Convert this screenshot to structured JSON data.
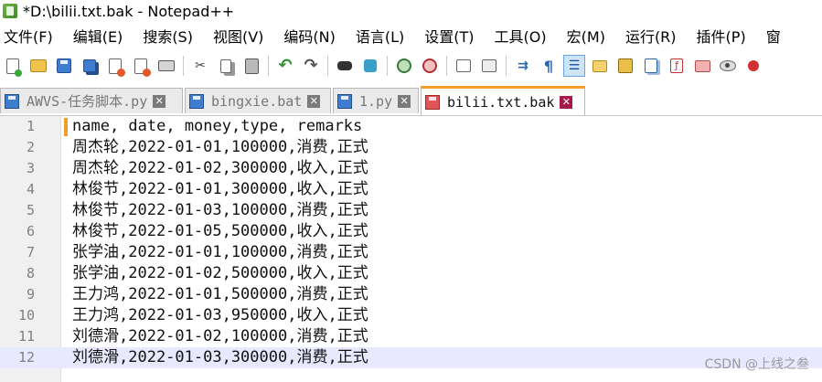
{
  "window": {
    "title": "*D:\\bilii.txt.bak - Notepad++"
  },
  "menu": [
    "文件(F)",
    "编辑(E)",
    "搜索(S)",
    "视图(V)",
    "编码(N)",
    "语言(L)",
    "设置(T)",
    "工具(O)",
    "宏(M)",
    "运行(R)",
    "插件(P)",
    "窗"
  ],
  "toolbar": {
    "buttons": [
      "new-icon",
      "open-icon",
      "save-icon",
      "save-all-icon",
      "close-icon",
      "close-all-icon",
      "print-icon",
      "cut-icon",
      "copy-icon",
      "paste-icon",
      "undo-icon",
      "redo-icon",
      "find-icon",
      "replace-icon",
      "zoom-in-icon",
      "zoom-out-icon",
      "sync-vertical-icon",
      "sync-horizontal-icon",
      "word-wrap-icon",
      "show-all-chars-icon",
      "indent-guide-icon",
      "user-defined-lang-icon",
      "document-map-icon",
      "document-list-icon",
      "function-list-icon",
      "folder-workspace-icon",
      "monitoring-icon",
      "record-macro-icon"
    ],
    "active": "indent-guide-icon"
  },
  "tabs": [
    {
      "label": "AWVS-任务脚本.py",
      "active": false
    },
    {
      "label": "bingxie.bat",
      "active": false
    },
    {
      "label": "1.py",
      "active": false
    },
    {
      "label": "bilii.txt.bak",
      "active": true
    }
  ],
  "editor": {
    "current_line": 12,
    "lines": [
      "name, date, money,type, remarks",
      "周杰轮,2022-01-01,100000,消费,正式",
      "周杰轮,2022-01-02,300000,收入,正式",
      "林俊节,2022-01-01,300000,收入,正式",
      "林俊节,2022-01-03,100000,消费,正式",
      "林俊节,2022-01-05,500000,收入,正式",
      "张学油,2022-01-01,100000,消费,正式",
      "张学油,2022-01-02,500000,收入,正式",
      "王力鸿,2022-01-01,500000,消费,正式",
      "王力鸿,2022-01-03,950000,收入,正式",
      "刘德滑,2022-01-02,100000,消费,正式",
      "刘德滑,2022-01-03,300000,消费,正式"
    ]
  },
  "watermark": "CSDN @上线之叁"
}
